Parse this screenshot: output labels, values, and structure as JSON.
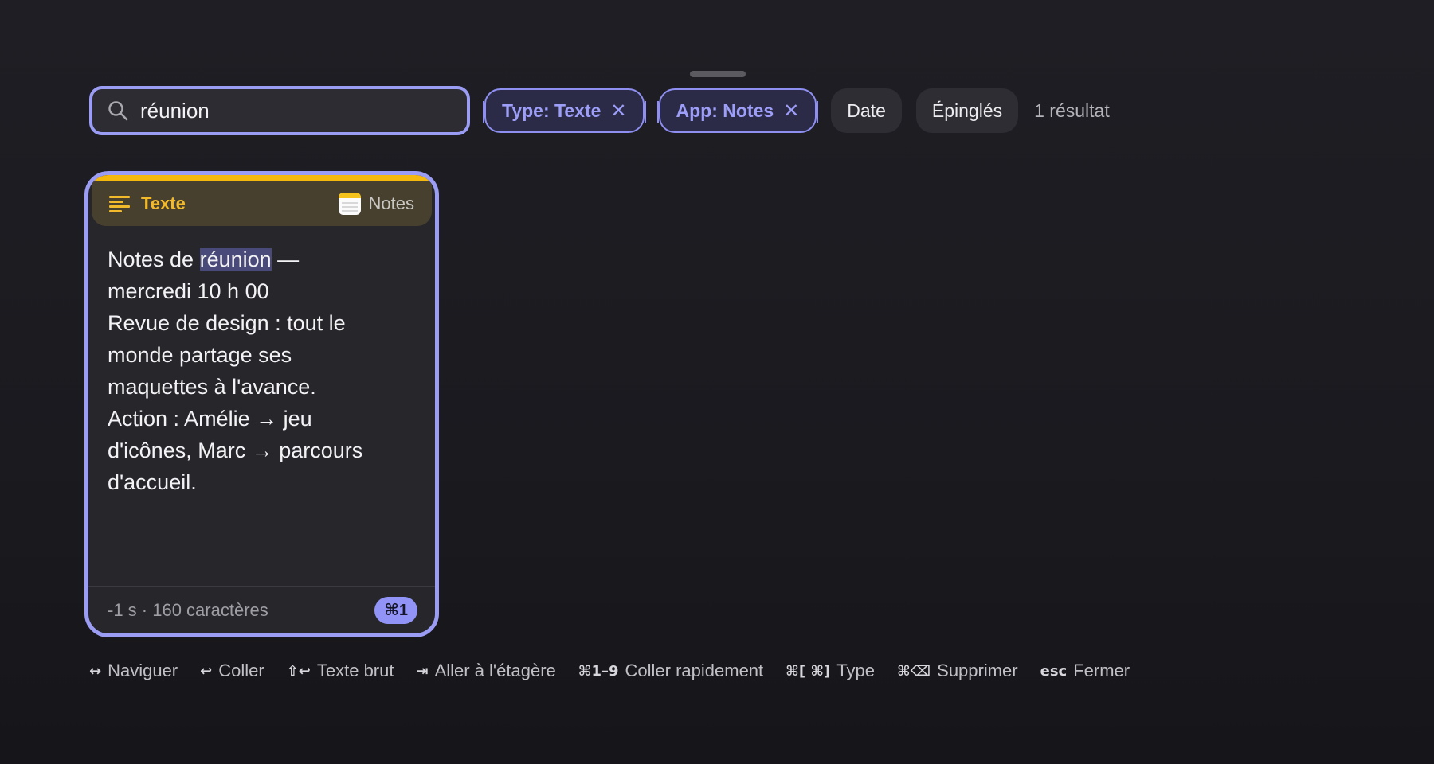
{
  "search": {
    "value": "réunion"
  },
  "filters": {
    "type_chip": "Type: Texte",
    "app_chip": "App: Notes",
    "date_chip": "Date",
    "pinned_chip": "Épinglés",
    "remove_glyph": "✕",
    "results_count": "1 résultat"
  },
  "card": {
    "type_label": "Texte",
    "app_label": "Notes",
    "body": {
      "before": "Notes de ",
      "highlight": "réunion",
      "after": " —\nmercredi 10 h 00\nRevue de design : tout le\nmonde partage ses\nmaquettes à l'avance.\nAction : Amélie → jeu\nd'icônes, Marc → parcours\nd'accueil."
    },
    "meta": "-1 s · 160 caractères",
    "shortcut": "⌘1"
  },
  "hints": [
    {
      "key": "↔",
      "label": "Naviguer"
    },
    {
      "key": "↩",
      "label": "Coller"
    },
    {
      "key": "⇧↩",
      "label": "Texte brut"
    },
    {
      "key": "⇥",
      "label": "Aller à l'étagère"
    },
    {
      "key": "⌘1–9",
      "label": "Coller rapidement"
    },
    {
      "key": "⌘[ ⌘]",
      "label": "Type"
    },
    {
      "key": "⌘⌫",
      "label": "Supprimer"
    },
    {
      "key": "esc",
      "label": "Fermer"
    }
  ],
  "colors": {
    "accent": "#9b9cf4",
    "text_type": "#f2b92b",
    "card_topbar": "#f5b80c"
  }
}
